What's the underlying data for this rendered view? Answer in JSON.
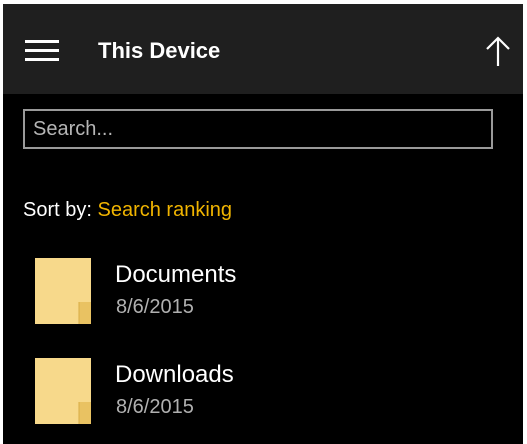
{
  "header": {
    "menu_icon": "hamburger-menu-icon",
    "title": "This Device",
    "up_icon": "arrow-up-icon"
  },
  "search": {
    "placeholder": "Search..."
  },
  "sort": {
    "label": "Sort by:",
    "value": "Search ranking"
  },
  "items": [
    {
      "icon": "folder-icon",
      "name": "Documents",
      "date": "8/6/2015"
    },
    {
      "icon": "folder-icon",
      "name": "Downloads",
      "date": "8/6/2015"
    }
  ],
  "colors": {
    "header_bg": "#1f1f1f",
    "background": "#000000",
    "accent": "#f0b400",
    "folder": "#f7d98b"
  }
}
